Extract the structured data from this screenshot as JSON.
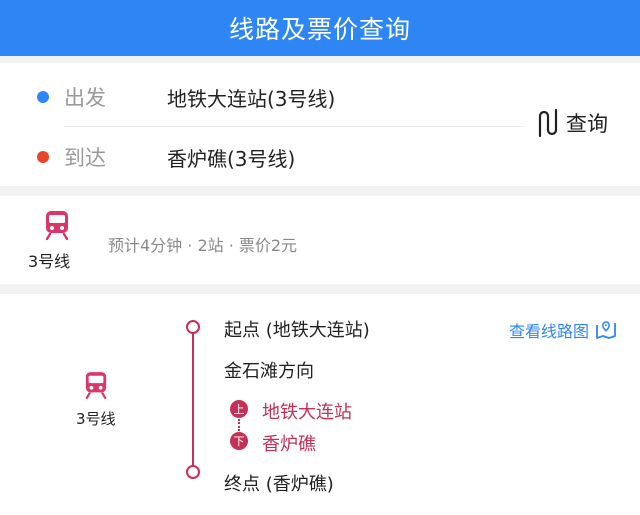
{
  "header": {
    "title": "线路及票价查询"
  },
  "od": {
    "from_label": "出发",
    "from_value": "地铁大连站(3号线)",
    "to_label": "到达",
    "to_value": "香炉礁(3号线)",
    "query_label": "查询",
    "from_dot_color": "#2f86f6",
    "to_dot_color": "#e8452c"
  },
  "summary": {
    "icon": "train-icon",
    "line": "3号线",
    "info": "预计4分钟 · 2站 · 票价2元"
  },
  "detail": {
    "icon": "train-icon",
    "line": "3号线",
    "start": "起点 (地铁大连站)",
    "direction": "金石滩方向",
    "board_badge": "上",
    "board_station": "地铁大连站",
    "alight_badge": "下",
    "alight_station": "香炉礁",
    "end": "终点 (香炉礁)",
    "map_link": "查看线路图",
    "line_color": "#c62f56"
  },
  "colors": {
    "accent": "#2e86f5"
  }
}
